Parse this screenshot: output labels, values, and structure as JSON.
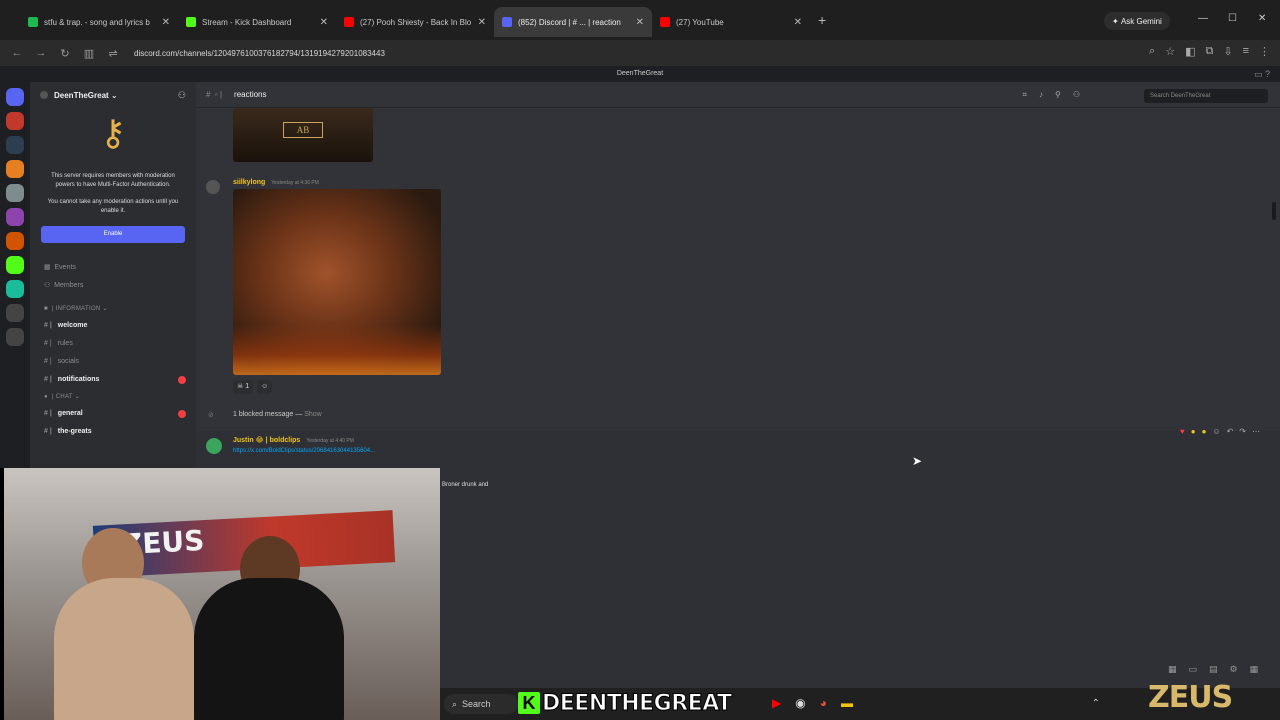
{
  "browser": {
    "tabs": [
      {
        "title": "stfu & trap. - song and lyrics b",
        "color": "#1db954",
        "active": false
      },
      {
        "title": "Stream - Kick Dashboard",
        "color": "#53fc18",
        "active": false
      },
      {
        "title": "(27) Pooh Shiesty - Back In Blo",
        "color": "#ff0000",
        "active": false
      },
      {
        "title": "(852) Discord | # ... | reaction",
        "color": "#5865f2",
        "active": true
      },
      {
        "title": "(27) YouTube",
        "color": "#ff0000",
        "active": false
      }
    ],
    "new_tab": "+",
    "gemini": "Ask Gemini",
    "url": "discord.com/channels/1204976100376182794/1319194279201083443",
    "bookmark_title": "DeenTheGreat"
  },
  "discord": {
    "server_name": "DeenTheGreat",
    "mfa_text": "This server requires members with moderation powers to have Multi-Factor Authentication.",
    "mfa_text2": "You cannot take any moderation actions until you enable it.",
    "enable_label": "Enable",
    "events": "Events",
    "members": "Members",
    "category_info": "INFORMATION",
    "category_chat": "CHAT",
    "channels_info": [
      {
        "name": "welcome",
        "bright": true,
        "ping": false
      },
      {
        "name": "rules",
        "bright": false,
        "ping": false
      },
      {
        "name": "socials",
        "bright": false,
        "ping": false
      },
      {
        "name": "notifications",
        "bright": true,
        "ping": true
      }
    ],
    "channels_chat": [
      {
        "name": "general",
        "bright": true,
        "ping": true
      },
      {
        "name": "the-greats",
        "bright": true,
        "ping": false
      }
    ],
    "channel_title": "reactions",
    "search_placeholder": "Search DeenTheGreat",
    "msg1_author": "siilkylong",
    "msg1_time": "Yesterday at 4:36 PM",
    "msg1_reaction_count": "1",
    "blocked_text": "1 blocked message —",
    "blocked_show": "Show",
    "msg2_author": "Justin 😂 | boldclips",
    "msg2_time": "Yesterday at 4:40 PM",
    "msg2_link": "https://x.com/BoldClips/status/20684163044135604...",
    "embed_text": "Broner drunk and"
  },
  "stream": {
    "streamer": "DEENTHEGREAT",
    "zeus": "ZEUS"
  },
  "taskbar": {
    "search": "Search"
  }
}
